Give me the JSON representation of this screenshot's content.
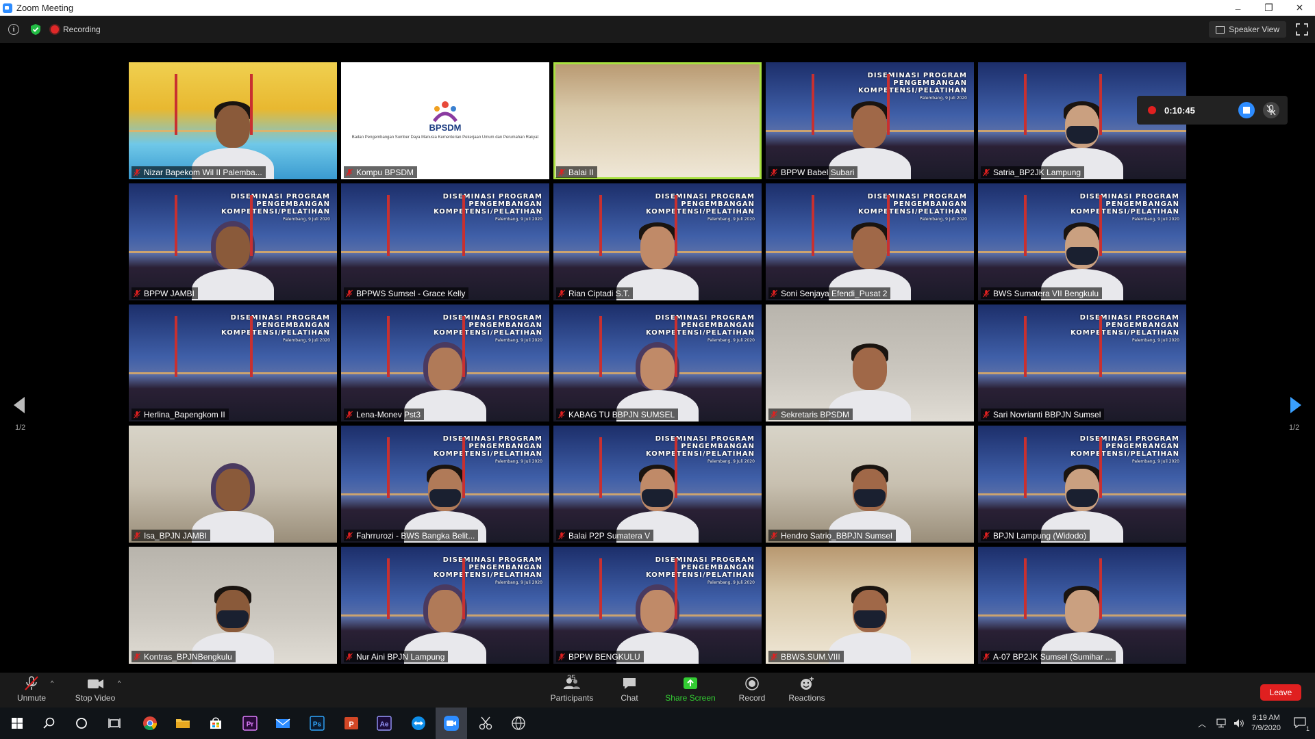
{
  "window": {
    "title": "Zoom Meeting",
    "minimize": "–",
    "restore": "❐",
    "close": "✕"
  },
  "topbar": {
    "recording_label": "Recording",
    "view_label": "Speaker View"
  },
  "gallery": {
    "page": "1/2",
    "tiles": [
      {
        "name": "Nizar Bapekom Wil II Palemba..."
      },
      {
        "name": "Kompu BPSDM"
      },
      {
        "name": "Balai II"
      },
      {
        "name": "BPPW Babel Subari"
      },
      {
        "name": "Satria_BP2JK Lampung"
      },
      {
        "name": "BPPW JAMBI"
      },
      {
        "name": "BPPWS Sumsel - Grace Kelly"
      },
      {
        "name": "Rian Ciptadi S.T."
      },
      {
        "name": "Soni Senjaya Efendi_Pusat 2"
      },
      {
        "name": "BWS Sumatera VII Bengkulu"
      },
      {
        "name": "Herlina_Bapengkom II"
      },
      {
        "name": "Lena-Monev Pst3"
      },
      {
        "name": "KABAG TU BBPJN SUMSEL"
      },
      {
        "name": "Sekretaris BPSDM"
      },
      {
        "name": "Sari Novrianti BBPJN Sumsel"
      },
      {
        "name": "Isa_BPJN JAMBI"
      },
      {
        "name": "Fahrrurozi - BWS Bangka Belit..."
      },
      {
        "name": "Balai P2P Sumatera V"
      },
      {
        "name": "Hendro Satrio_BBPJN Sumsel"
      },
      {
        "name": "BPJN Lampung (Widodo)"
      },
      {
        "name": "Kontras_BPJNBengkulu"
      },
      {
        "name": "Nur Aini BPJN Lampung"
      },
      {
        "name": "BPPW BENGKULU"
      },
      {
        "name": "BBWS.SUM.VIII"
      },
      {
        "name": "A-07 BP2JK Sumsel   (Sumihar ..."
      }
    ],
    "banner": {
      "line1": "DISEMINASI PROGRAM",
      "line2": "PENGEMBANGAN",
      "line3": "KOMPETENSI/PELATIHAN",
      "line4": "Palembang, 9 Juli 2020"
    },
    "bpsdm_logo_text": "BPSDM",
    "bpsdm_subtitle": "Badan Pengembangan Sumber Daya Manusia Kementerian Pekerjaan Umum dan Perumahan Rakyat"
  },
  "recording_timer": {
    "time": "0:10:45"
  },
  "toolbar": {
    "unmute": "Unmute",
    "stop_video": "Stop Video",
    "participants": "Participants",
    "participant_count": "35",
    "chat": "Chat",
    "share_screen": "Share Screen",
    "record": "Record",
    "reactions": "Reactions",
    "leave": "Leave"
  },
  "taskbar": {
    "time": "9:19 AM",
    "date": "7/9/2020",
    "notification_count": "1"
  },
  "colors": {
    "accent": "#2d8cff",
    "leave": "#e02020",
    "share": "#33cc33",
    "active_speaker": "#a8e040"
  }
}
